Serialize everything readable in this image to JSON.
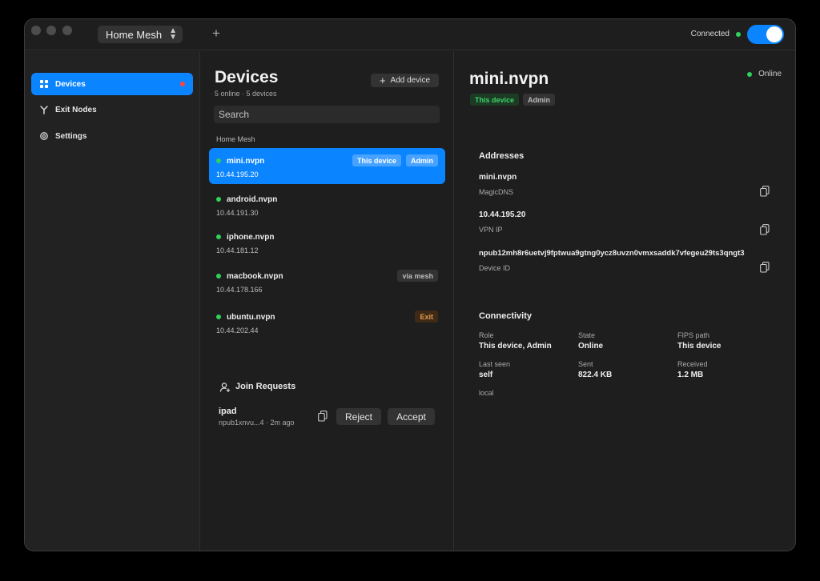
{
  "titlebar": {
    "mesh_name": "Home Mesh",
    "connection_status": "Connected",
    "toggle_on": true
  },
  "sidebar": {
    "items": [
      {
        "label": "Devices",
        "icon": "grid-icon",
        "active": true,
        "badge": true
      },
      {
        "label": "Exit Nodes",
        "icon": "fork-icon",
        "active": false
      },
      {
        "label": "Settings",
        "icon": "gear-icon",
        "active": false
      }
    ]
  },
  "devices": {
    "title": "Devices",
    "summary": "5 online · 5 devices",
    "add_label": "Add device",
    "search_placeholder": "Search",
    "group_label": "Home Mesh",
    "list": [
      {
        "name": "mini.nvpn",
        "ip": "10.44.195.20",
        "tags": [
          "This device",
          "Admin"
        ],
        "selected": true
      },
      {
        "name": "android.nvpn",
        "ip": "10.44.191.30",
        "tags": []
      },
      {
        "name": "iphone.nvpn",
        "ip": "10.44.181.12",
        "tags": []
      },
      {
        "name": "macbook.nvpn",
        "ip": "10.44.178.166",
        "tags": [
          "via mesh"
        ]
      },
      {
        "name": "ubuntu.nvpn",
        "ip": "10.44.202.44",
        "tags": [
          "Exit"
        ]
      }
    ]
  },
  "join_requests": {
    "title": "Join Requests",
    "items": [
      {
        "name": "ipad",
        "sub": "npub1xnvu...4 · 2m ago",
        "reject_label": "Reject",
        "accept_label": "Accept"
      }
    ]
  },
  "detail": {
    "title": "mini.nvpn",
    "status": "Online",
    "tags": [
      "This device",
      "Admin"
    ],
    "addresses_title": "Addresses",
    "addresses": [
      {
        "value": "mini.nvpn",
        "label": "MagicDNS"
      },
      {
        "value": "10.44.195.20",
        "label": "VPN IP"
      },
      {
        "value": "npub12mh8r6uetvj9fptwua9gtng0ycz8uvzn0vmxsaddk7vfegeu29ts3qngt3",
        "label": "Device ID"
      }
    ],
    "connectivity_title": "Connectivity",
    "connectivity": {
      "role_label": "Role",
      "role_value": "This device, Admin",
      "state_label": "State",
      "state_value": "Online",
      "fips_label": "FIPS path",
      "fips_value": "This device",
      "lastseen_label": "Last seen",
      "lastseen_value": "self",
      "sent_label": "Sent",
      "sent_value": "822.4 KB",
      "received_label": "Received",
      "received_value": "1.2 MB",
      "extra": "local"
    }
  },
  "colors": {
    "accent": "#0a84ff",
    "online": "#30d158",
    "exit": "#e09a4c"
  }
}
